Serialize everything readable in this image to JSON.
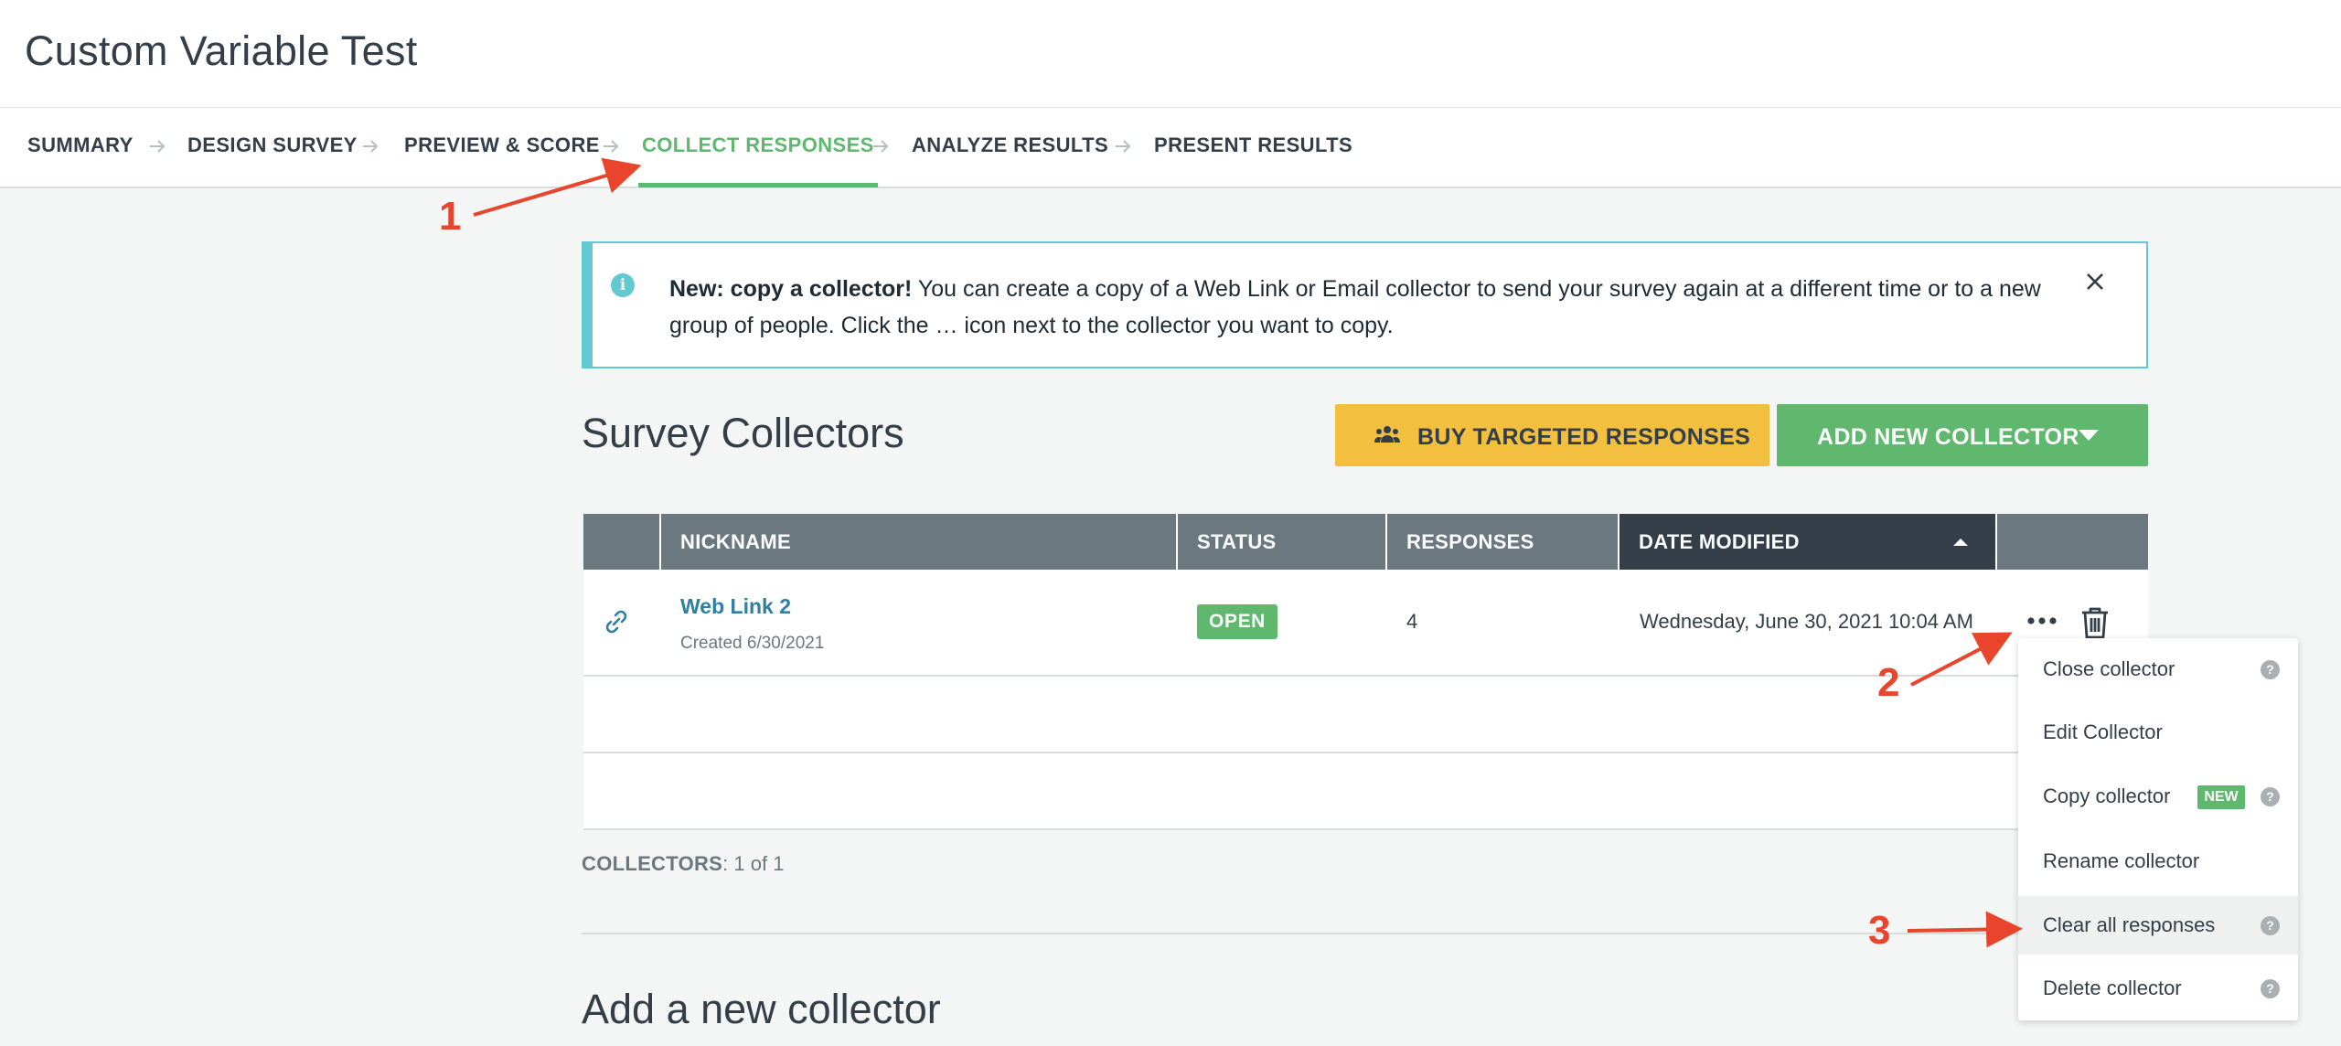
{
  "page": {
    "title": "Custom Variable Test"
  },
  "nav": {
    "steps": [
      {
        "label": "SUMMARY"
      },
      {
        "label": "DESIGN SURVEY"
      },
      {
        "label": "PREVIEW & SCORE"
      },
      {
        "label": "COLLECT RESPONSES",
        "active": true
      },
      {
        "label": "ANALYZE RESULTS"
      },
      {
        "label": "PRESENT RESULTS"
      }
    ]
  },
  "annotations": {
    "one": "1",
    "two": "2",
    "three": "3"
  },
  "banner": {
    "icon": "info-icon",
    "title": "New: copy a collector!",
    "text": " You can create a copy of a Web Link or Email collector to send your survey again at a different time or to a new group of people. Click the … icon next to the collector you want to copy."
  },
  "collectors": {
    "title": "Survey Collectors",
    "buy_label": "BUY TARGETED RESPONSES",
    "add_label": "ADD NEW COLLECTOR",
    "table": {
      "headers": [
        "NICKNAME",
        "STATUS",
        "RESPONSES",
        "DATE MODIFIED"
      ],
      "rows": [
        {
          "icon": "link-icon",
          "nickname": "Web Link 2",
          "created": "Created 6/30/2021",
          "status": "OPEN",
          "responses": "4",
          "date_modified": "Wednesday, June 30, 2021 10:04 AM"
        }
      ]
    },
    "count_label": "COLLECTORS",
    "count_value": ": 1 of 1"
  },
  "add_new": {
    "title": "Add a new collector"
  },
  "menu": {
    "items": [
      {
        "label": "Close collector",
        "help": "?"
      },
      {
        "label": "Edit Collector"
      },
      {
        "label": "Copy collector",
        "badge": "NEW",
        "help": "?"
      },
      {
        "label": "Rename collector"
      },
      {
        "label": "Clear all responses",
        "help": "?"
      },
      {
        "label": "Delete collector",
        "help": "?"
      }
    ]
  },
  "colors": {
    "accent_green": "#5fb86e",
    "info_teal": "#62c9d2",
    "button_yellow": "#f2bf3f",
    "annotation_red": "#e8452c",
    "table_header": "#6b787f",
    "table_header_sorted": "#333e48",
    "link_blue": "#2e7fa0"
  }
}
